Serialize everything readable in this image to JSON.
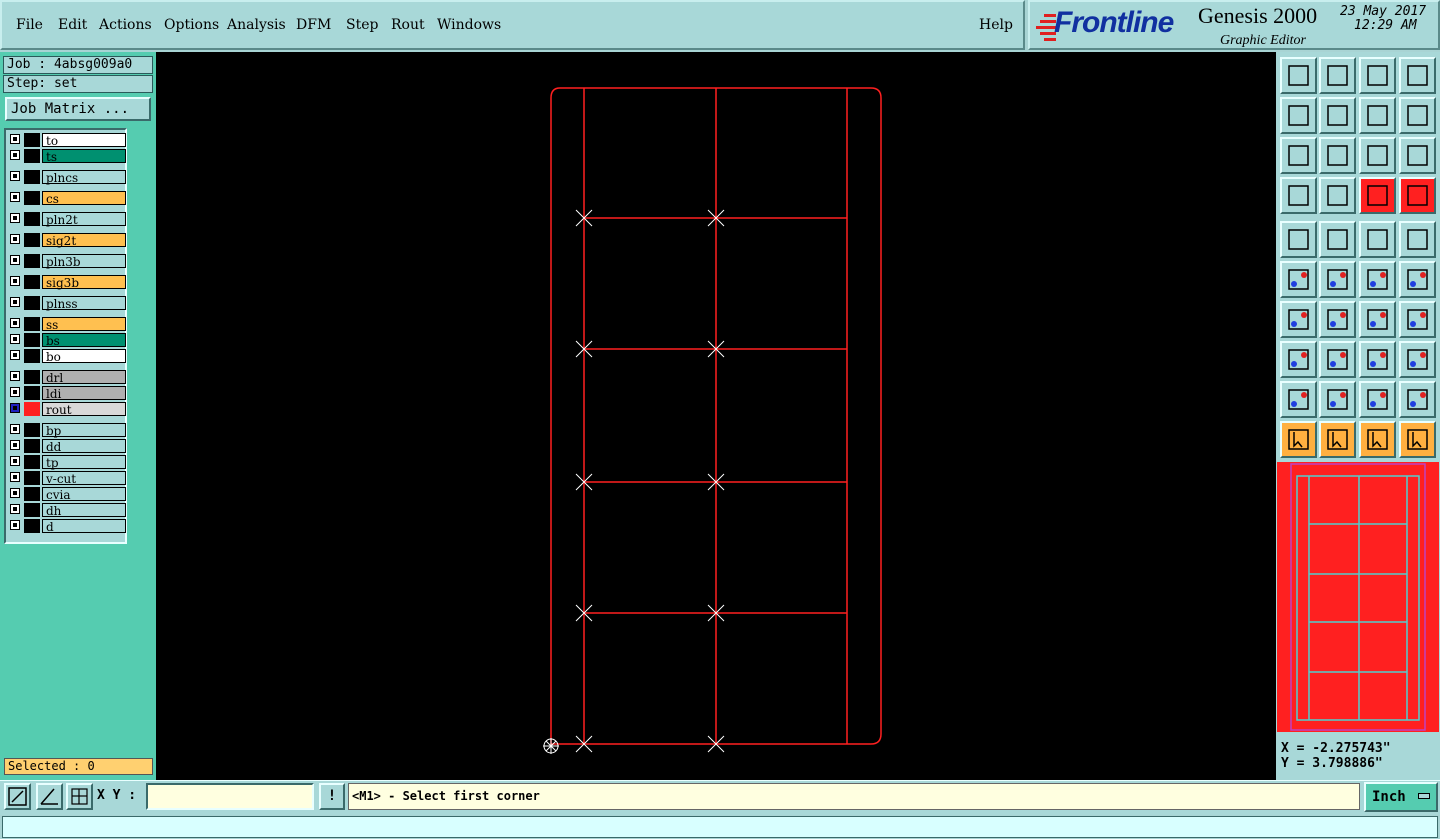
{
  "menu": {
    "items": [
      "File",
      "Edit",
      "Actions",
      "Options",
      "Analysis",
      "DFM",
      "Step",
      "Rout",
      "Windows"
    ],
    "help": "Help"
  },
  "brand": {
    "logo": "Frontline",
    "product": "Genesis 2000",
    "subtitle": "Graphic Editor",
    "date": "23 May 2017",
    "time": "12:29 AM"
  },
  "job": {
    "job_label": "Job : 4absg009a0",
    "step_label": "Step: set",
    "matrix_button": "Job Matrix ..."
  },
  "layers": [
    {
      "name": "to",
      "color": "#ffffff"
    },
    {
      "name": "ts",
      "color": "#009070"
    },
    {
      "name": "plncs",
      "color": "#a8d8d8"
    },
    {
      "name": "cs",
      "color": "#ffc050"
    },
    {
      "name": "pln2t",
      "color": "#a8d8d8"
    },
    {
      "name": "sig2t",
      "color": "#ffc050"
    },
    {
      "name": "pln3b",
      "color": "#a8d8d8"
    },
    {
      "name": "sig3b",
      "color": "#ffc050"
    },
    {
      "name": "plnss",
      "color": "#a8d8d8"
    },
    {
      "name": "ss",
      "color": "#ffc050"
    },
    {
      "name": "bs",
      "color": "#009070"
    },
    {
      "name": "bo",
      "color": "#ffffff"
    },
    {
      "name": "drl",
      "color": "#b0b0b0"
    },
    {
      "name": "ldi",
      "color": "#b0b0b0"
    },
    {
      "name": "rout",
      "color": "#d8d8d8",
      "active": true
    },
    {
      "name": "bp",
      "color": "#a8d8d8"
    },
    {
      "name": "dd",
      "color": "#a8d8d8"
    },
    {
      "name": "tp",
      "color": "#a8d8d8"
    },
    {
      "name": "v-cut",
      "color": "#a8d8d8"
    },
    {
      "name": "cvia",
      "color": "#a8d8d8"
    },
    {
      "name": "dh",
      "color": "#a8d8d8"
    },
    {
      "name": "d",
      "color": "#a8d8d8"
    }
  ],
  "selected": "Selected : 0",
  "coords": {
    "x": "X = -2.275743\"",
    "y": "Y = 3.798886\""
  },
  "bottom": {
    "xy_label": "X Y :",
    "xy_value": "",
    "message": "<M1> - Select first corner",
    "unit": "Inch",
    "excl": "!"
  },
  "colors": {
    "rout": "#ff2020",
    "accent": "#55ccb0",
    "panel": "#a8d8d8",
    "marker": "#ffffff"
  }
}
